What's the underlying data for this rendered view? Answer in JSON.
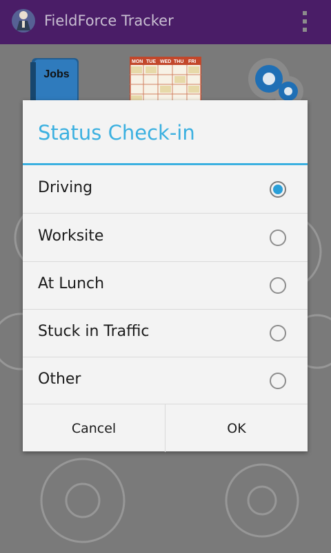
{
  "app": {
    "title": "FieldForce Tracker",
    "logo_icon": "fieldforce-logo-icon",
    "overflow_icon": "overflow-menu-icon"
  },
  "home": {
    "tiles": [
      {
        "label": "Jobs",
        "icon": "jobs-book-icon"
      },
      {
        "icon": "schedule-calendar-icon",
        "days": [
          "MON",
          "TUE",
          "WED",
          "THU",
          "FRI"
        ]
      },
      {
        "icon": "settings-gears-icon"
      }
    ]
  },
  "dialog": {
    "title": "Status Check-in",
    "options": [
      {
        "label": "Driving",
        "selected": true
      },
      {
        "label": "Worksite",
        "selected": false
      },
      {
        "label": "At Lunch",
        "selected": false
      },
      {
        "label": "Stuck in Traffic",
        "selected": false
      },
      {
        "label": "Other",
        "selected": false
      }
    ],
    "cancel_label": "Cancel",
    "ok_label": "OK"
  },
  "colors": {
    "appbar": "#4a1d67",
    "accent": "#3bb0e0",
    "radio_selected": "#2a9fd8"
  }
}
